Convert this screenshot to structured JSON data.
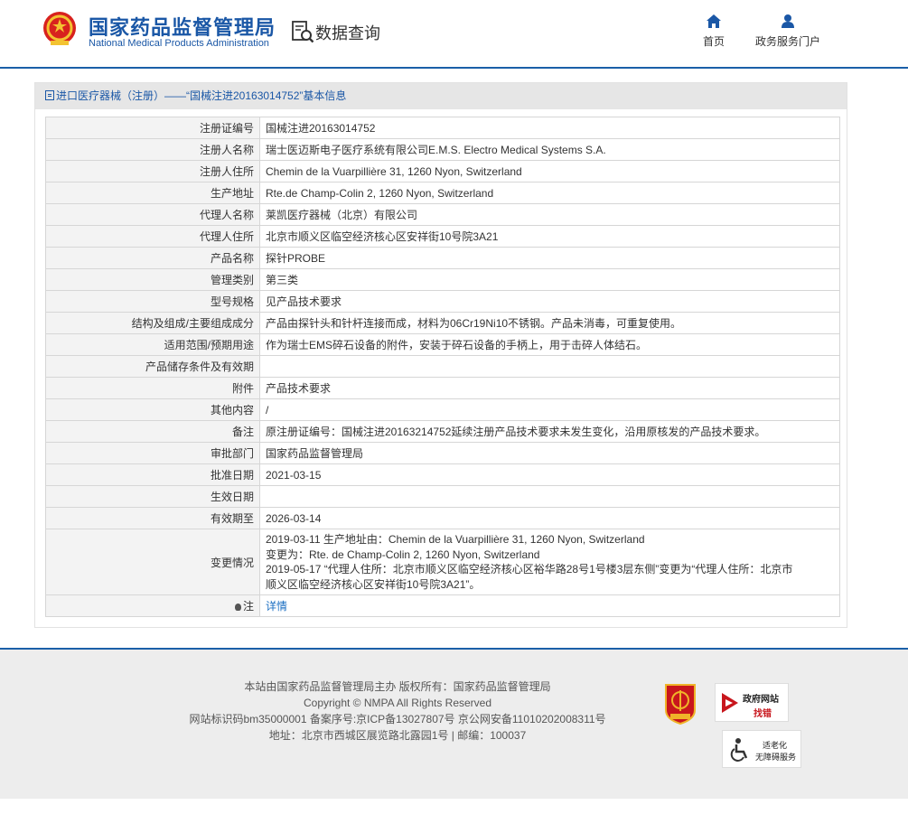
{
  "header": {
    "org_name_cn": "国家药品监督管理局",
    "org_name_en": "National Medical Products Administration",
    "query_label": "数据查询",
    "nav": [
      {
        "label": "首页",
        "icon": "home-icon"
      },
      {
        "label": "政务服务门户",
        "icon": "user-icon"
      }
    ]
  },
  "panel": {
    "breadcrumb": "进口医疗器械（注册）——“国械注进20163014752”基本信息"
  },
  "rows": [
    {
      "key": "注册证编号",
      "value": "国械注进20163014752"
    },
    {
      "key": "注册人名称",
      "value": "瑞士医迈斯电子医疗系统有限公司E.M.S. Electro Medical Systems S.A."
    },
    {
      "key": "注册人住所",
      "value": "Chemin de la Vuarpillière 31, 1260 Nyon, Switzerland"
    },
    {
      "key": "生产地址",
      "value": "Rte.de Champ-Colin 2, 1260 Nyon, Switzerland"
    },
    {
      "key": "代理人名称",
      "value": "莱凯医疗器械（北京）有限公司"
    },
    {
      "key": "代理人住所",
      "value": "北京市顺义区临空经济核心区安祥街10号院3A21"
    },
    {
      "key": "产品名称",
      "value": "探针PROBE"
    },
    {
      "key": "管理类别",
      "value": "第三类"
    },
    {
      "key": "型号规格",
      "value": "见产品技术要求"
    },
    {
      "key": "结构及组成/主要组成成分",
      "value": "产品由探针头和针杆连接而成，材料为06Cr19Ni10不锈钢。产品未消毒，可重复使用。"
    },
    {
      "key": "适用范围/预期用途",
      "value": "作为瑞士EMS碎石设备的附件，安装于碎石设备的手柄上，用于击碎人体结石。"
    },
    {
      "key": "产品储存条件及有效期",
      "value": ""
    },
    {
      "key": "附件",
      "value": "产品技术要求"
    },
    {
      "key": "其他内容",
      "value": "/"
    },
    {
      "key": "备注",
      "value": "原注册证编号：国械注进20163214752延续注册产品技术要求未发生变化，沿用原核发的产品技术要求。"
    },
    {
      "key": "审批部门",
      "value": "国家药品监督管理局"
    },
    {
      "key": "批准日期",
      "value": "2021-03-15"
    },
    {
      "key": "生效日期",
      "value": ""
    },
    {
      "key": "有效期至",
      "value": "2026-03-14"
    }
  ],
  "change": {
    "key": "变更情况",
    "lines": [
      "2019-03-11 生产地址由：Chemin de la Vuarpillière 31, 1260 Nyon, Switzerland",
      "变更为：Rte. de Champ-Colin 2, 1260 Nyon, Switzerland",
      "2019-05-17 “代理人住所：北京市顺义区临空经济核心区裕华路28号1号楼3层东侧”变更为“代理人住所：北京市",
      "顺义区临空经济核心区安祥街10号院3A21”。"
    ]
  },
  "note": {
    "key": "注",
    "link": "详情"
  },
  "footer": {
    "lines": [
      "本站由国家药品监督管理局主办 版权所有：国家药品监督管理局",
      "Copyright © NMPA All Rights Reserved",
      "网站标识码bm35000001    备案序号:京ICP备13027807号    京公网安备11010202008311号",
      "地址：北京市西城区展览路北露园1号 | 邮编：100037"
    ],
    "badge_red": "党政机关",
    "badge_gov": {
      "line1": "政府网站",
      "line2": "找错"
    },
    "badge_acc": {
      "line1": "适老化",
      "line2": "无障碍服务"
    }
  },
  "colors": {
    "brand_blue": "#1a57a6",
    "link_blue": "#1a6ec2",
    "badge_red": "#c8161d"
  }
}
